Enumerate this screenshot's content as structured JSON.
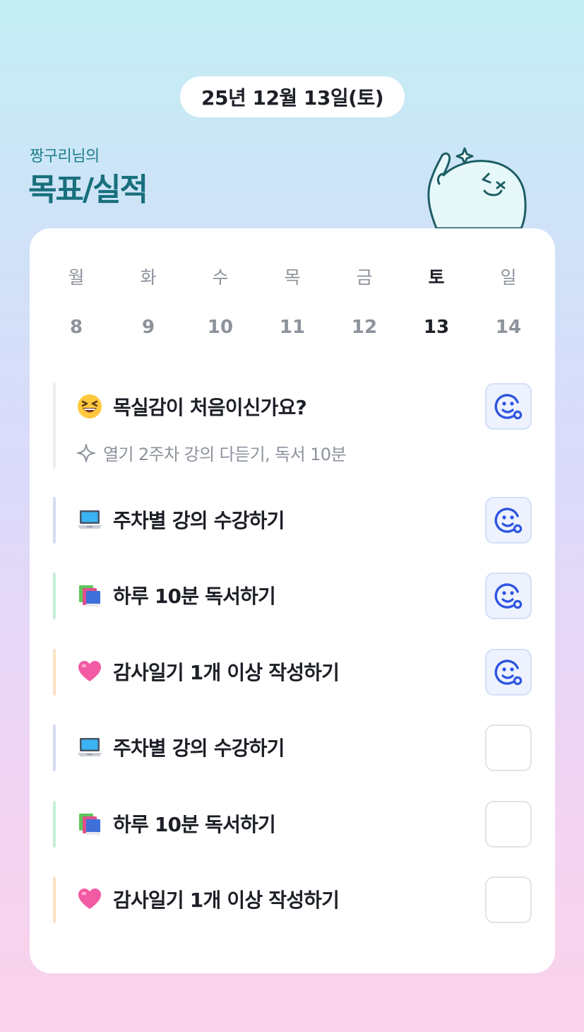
{
  "header": {
    "date": "25년 12월 13일(토)",
    "owner": "짱구리님의",
    "title": "목표/실적"
  },
  "week": [
    {
      "dow": "월",
      "date": "8",
      "active": false
    },
    {
      "dow": "화",
      "date": "9",
      "active": false
    },
    {
      "dow": "수",
      "date": "10",
      "active": false
    },
    {
      "dow": "목",
      "date": "11",
      "active": false
    },
    {
      "dow": "금",
      "date": "12",
      "active": false
    },
    {
      "dow": "토",
      "date": "13",
      "active": true
    },
    {
      "dow": "일",
      "date": "14",
      "active": false
    }
  ],
  "goals": [
    {
      "icon": "grinning-squinting-face-icon",
      "title": "목실감이 처음이신가요?",
      "subtitle": "열기 2주차 강의 다듣기, 독서 10분",
      "done": true,
      "accent": "#eceef1"
    },
    {
      "icon": "laptop-icon",
      "title": "주차별 강의 수강하기",
      "done": true,
      "accent": "#d5ddf4"
    },
    {
      "icon": "books-icon",
      "title": "하루 10분 독서하기",
      "done": true,
      "accent": "#c4efd9"
    },
    {
      "icon": "pink-heart-icon",
      "title": "감사일기 1개 이상 작성하기",
      "done": true,
      "accent": "#fbe2c2"
    },
    {
      "icon": "laptop-icon",
      "title": "주차별 강의 수강하기",
      "done": false,
      "accent": "#d5ddf4"
    },
    {
      "icon": "books-icon",
      "title": "하루 10분 독서하기",
      "done": false,
      "accent": "#c4efd9"
    },
    {
      "icon": "pink-heart-icon",
      "title": "감사일기 1개 이상 작성하기",
      "done": false,
      "accent": "#fbe2c2"
    }
  ],
  "colors": {
    "check_blue": "#2f55e0",
    "heading_teal": "#186f7c"
  }
}
